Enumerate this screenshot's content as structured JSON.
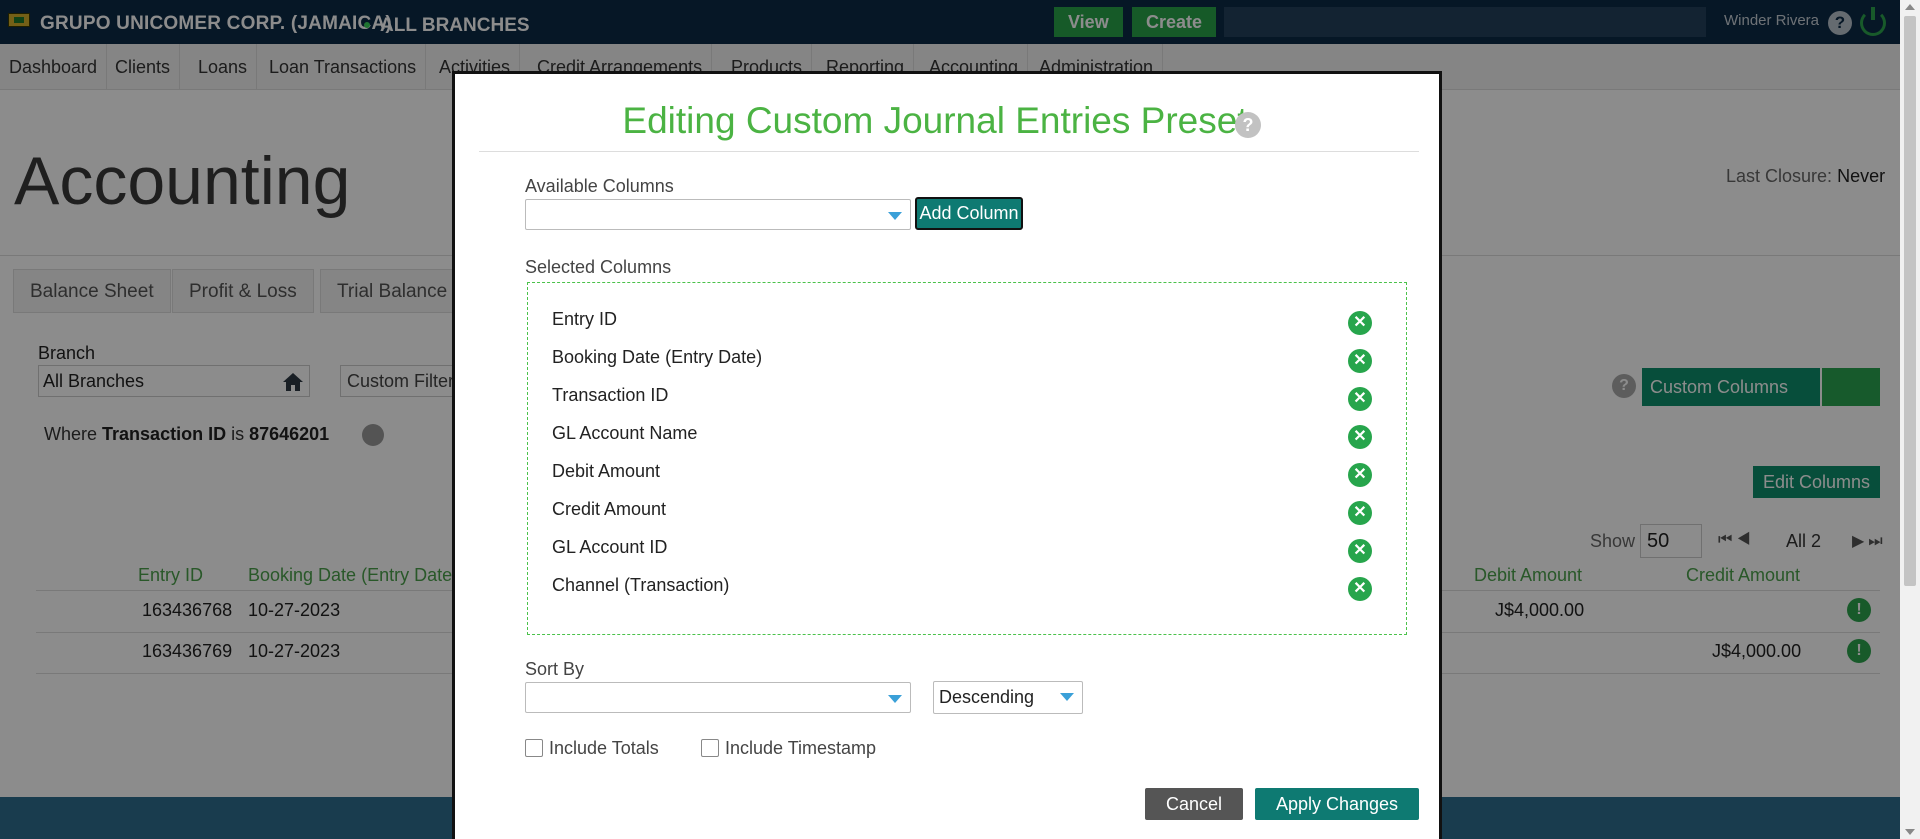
{
  "header": {
    "brand": "GRUPO UNICOMER CORP. (JAMAICA)",
    "branch": "ALL BRANCHES",
    "view_label": "View",
    "create_label": "Create",
    "user": "Winder Rivera",
    "help_glyph": "?"
  },
  "nav": [
    "Dashboard",
    "Clients",
    "Loans",
    "Loan Transactions",
    "Activities",
    "Credit Arrangements",
    "Products",
    "Reporting",
    "Accounting",
    "Administration"
  ],
  "page": {
    "title": "Accounting",
    "last_closure_label": "Last Closure:",
    "last_closure_value": "Never",
    "tabs": [
      "Balance Sheet",
      "Profit & Loss",
      "Trial Balance"
    ],
    "branch_label": "Branch",
    "branch_value": "All Branches",
    "custom_filter": "Custom Filter",
    "where_prefix": "Where",
    "where_field": "Transaction ID",
    "where_op": "is",
    "where_value": "87646201",
    "custom_columns": "Custom  Columns",
    "edit_columns": "Edit  Columns",
    "show_label": "Show",
    "show_value": "50",
    "pager_all": "All 2"
  },
  "table": {
    "headers": [
      "Entry ID",
      "Booking Date (Entry Date)",
      "Debit Amount",
      "Credit Amount"
    ],
    "rows": [
      {
        "entry_id": "163436768",
        "date": "10-27-2023",
        "debit": "J$4,000.00",
        "credit": ""
      },
      {
        "entry_id": "163436769",
        "date": "10-27-2023",
        "debit": "",
        "credit": "J$4,000.00"
      }
    ],
    "status_glyph": "!"
  },
  "modal": {
    "title": "Editing Custom Journal Entries Preset",
    "help_glyph": "?",
    "available_label": "Available Columns",
    "available_value": "",
    "add_column": "Add Column",
    "selected_label": "Selected Columns",
    "selected_columns": [
      "Entry ID",
      "Booking Date (Entry Date)",
      "Transaction ID",
      "GL Account Name",
      "Debit Amount",
      "Credit Amount",
      "GL Account ID",
      "Channel (Transaction)"
    ],
    "remove_glyph": "✕",
    "sort_label": "Sort By",
    "sort_value": "",
    "sort_direction": "Descending",
    "include_totals": "Include Totals",
    "include_timestamp": "Include Timestamp",
    "cancel": "Cancel",
    "apply": "Apply Changes"
  },
  "colors": {
    "accent_green": "#4bb343",
    "teal": "#0e7a72",
    "navy": "#0b2a45"
  }
}
